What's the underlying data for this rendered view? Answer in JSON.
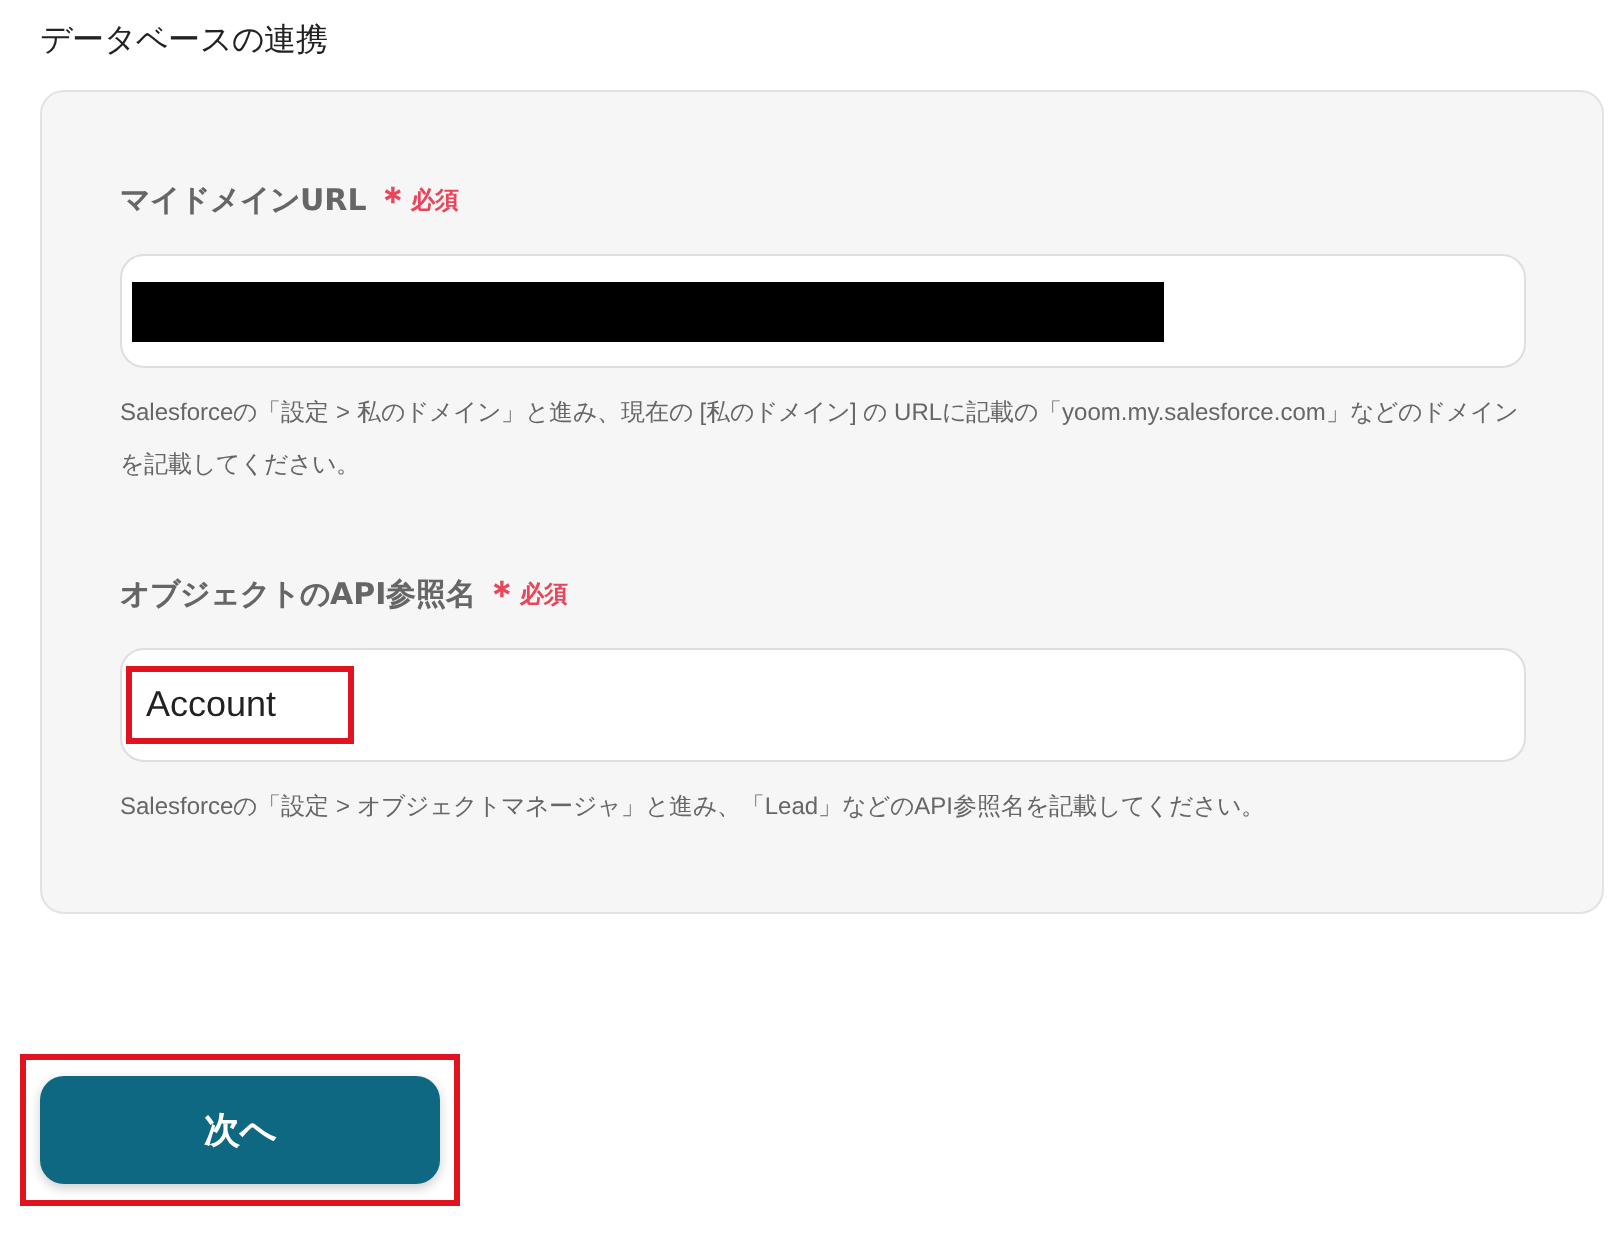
{
  "section_title": "データベースの連携",
  "fields": [
    {
      "label": "マイドメインURL",
      "required_mark": "＊",
      "required_text": "必須",
      "value_redacted": true,
      "help": "Salesforceの「設定 > 私のドメイン」と進み、現在の [私のドメイン] の URLに記載の「yoom.my.salesforce.com」などのドメインを記載してください。"
    },
    {
      "label": "オブジェクトのAPI参照名",
      "required_mark": "＊",
      "required_text": "必須",
      "value": "Account",
      "highlighted": true,
      "help": "Salesforceの「設定 > オブジェクトマネージャ」と進み、「Lead」などのAPI参照名を記載してください。"
    }
  ],
  "next_button": {
    "label": "次へ",
    "highlighted": true
  }
}
